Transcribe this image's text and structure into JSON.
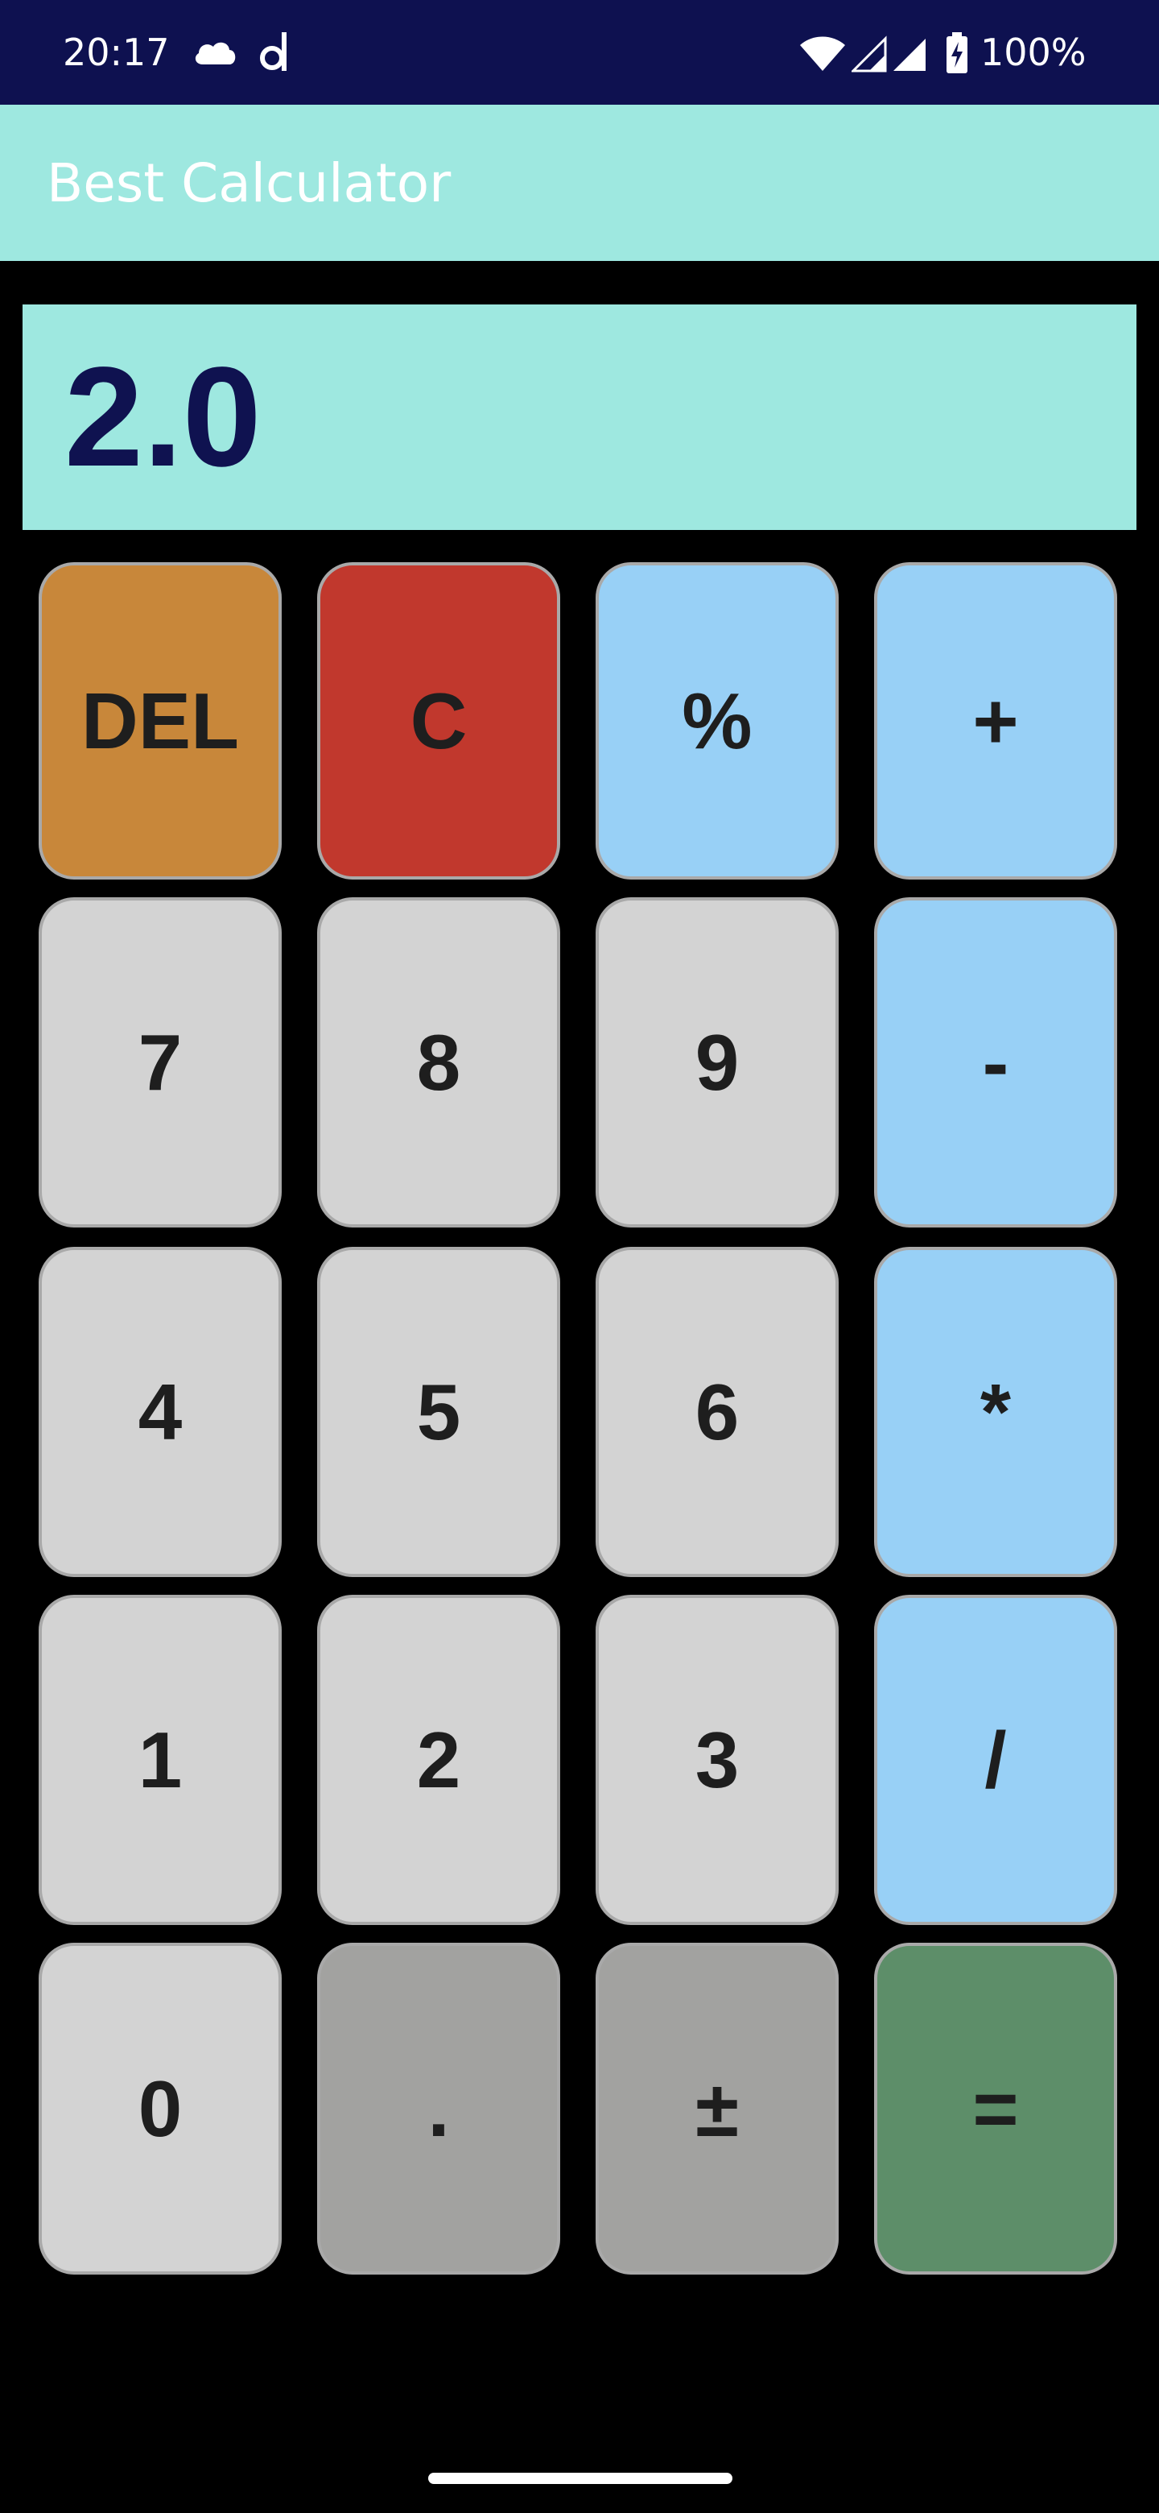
{
  "status_bar": {
    "time": "20:17",
    "battery": "100%",
    "icons": [
      "cloud-icon",
      "d-letter-icon",
      "wifi-icon",
      "signal-icon",
      "signal-icon",
      "battery-charging-icon"
    ]
  },
  "app_bar": {
    "title": "Best Calculator"
  },
  "display": {
    "value": "2.0"
  },
  "keys": {
    "del": "DEL",
    "clear": "C",
    "percent": "%",
    "plus": "+",
    "seven": "7",
    "eight": "8",
    "nine": "9",
    "minus": "-",
    "four": "4",
    "five": "5",
    "six": "6",
    "multiply": "*",
    "one": "1",
    "two": "2",
    "three": "3",
    "divide": "/",
    "zero": "0",
    "dot": ".",
    "sign": "±",
    "equals": "="
  },
  "colors": {
    "status_bar": "#0e1150",
    "app_bar": "#9ee8e0",
    "display_text": "#0f1250",
    "del_key": "#c8873a",
    "clear_key": "#c1382d",
    "operator_key": "#98d0f6",
    "number_key": "#d3d3d3",
    "dark_key": "#a2a2a0",
    "equals_key": "#5d8e69"
  }
}
